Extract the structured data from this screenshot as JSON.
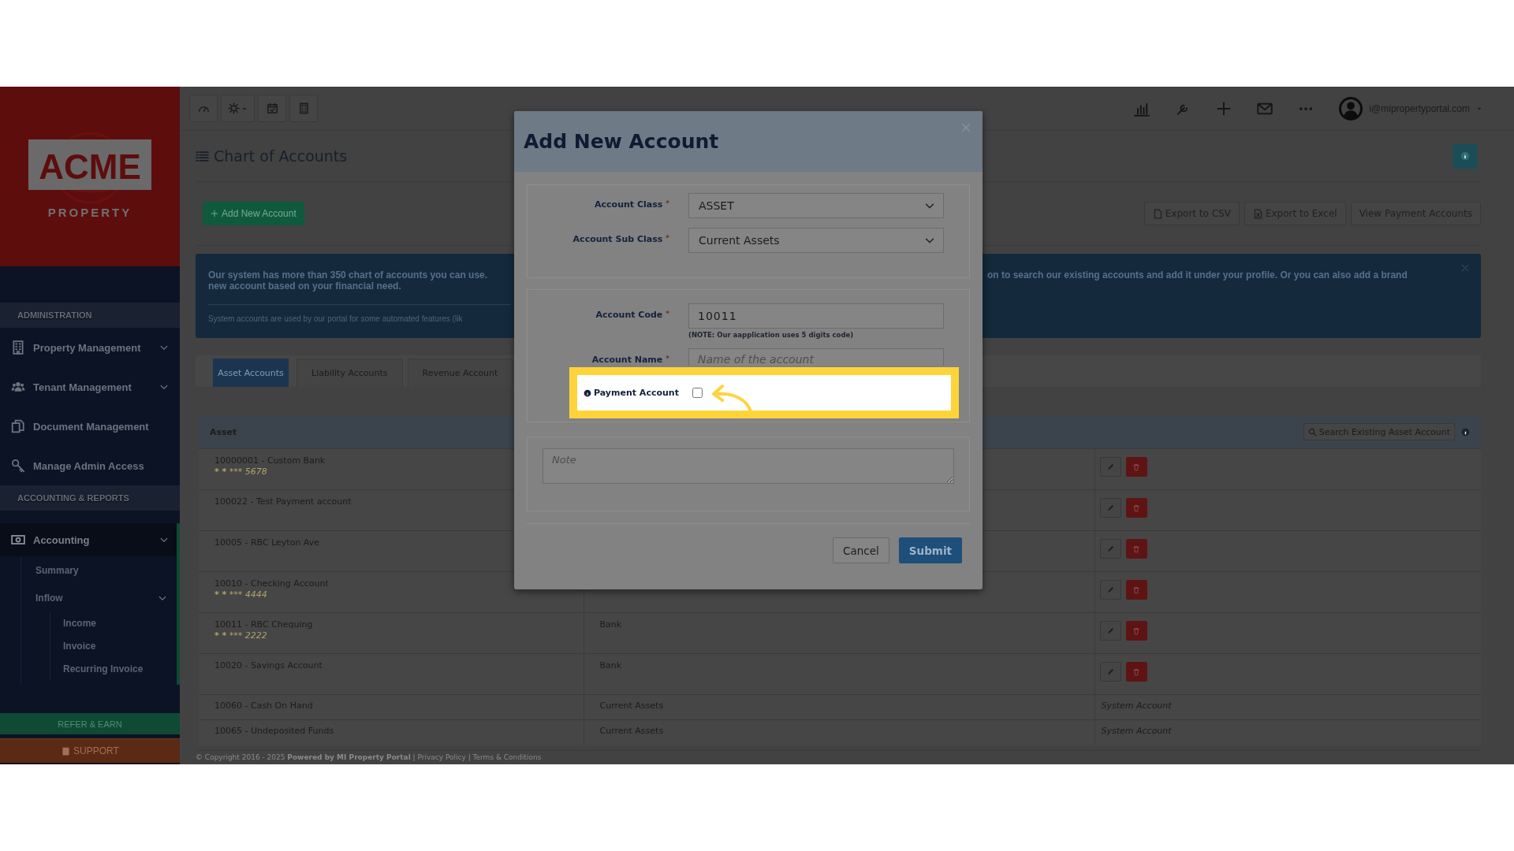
{
  "sidebar": {
    "logo": {
      "wordmark": "ACME",
      "tagline": "PROPERTY"
    },
    "sections": [
      {
        "title": "ADMINISTRATION",
        "items": [
          {
            "label": "Property Management",
            "submenu": true,
            "selected": false
          },
          {
            "label": "Tenant Management",
            "submenu": true,
            "selected": false
          },
          {
            "label": "Document Management",
            "submenu": false,
            "selected": false
          },
          {
            "label": "Manage Admin Access",
            "submenu": false,
            "selected": false
          }
        ]
      },
      {
        "title": "ACCOUNTING & REPORTS",
        "items": [
          {
            "label": "Accounting",
            "submenu": true,
            "selected": true,
            "children": [
              {
                "label": "Summary",
                "submenu": false,
                "selected": false
              },
              {
                "label": "Inflow",
                "submenu": true,
                "selected": false,
                "children": [
                  {
                    "label": "Income",
                    "selected": false
                  },
                  {
                    "label": "Invoice",
                    "selected": false
                  },
                  {
                    "label": "Recurring Invoice",
                    "selected": false
                  }
                ]
              }
            ]
          }
        ]
      }
    ],
    "refer": "REFER & EARN",
    "support": "SUPPORT"
  },
  "topbar": {
    "left_tools": [
      {
        "caret": false
      },
      {
        "caret": true
      },
      {
        "caret": false
      },
      {
        "caret": false
      }
    ],
    "user_email": "i@mipropertyportal.com"
  },
  "page": {
    "title": "Chart of Accounts",
    "add_button": "Add New Account",
    "export_buttons": [
      "Export to CSV",
      "Export to Excel",
      "View Payment Accounts"
    ]
  },
  "banner": {
    "left_lines": [
      "Our system has more than 350 chart of accounts you can use.",
      "new account based on your financial need.",
      "System accounts are used by our portal for some automated features (lik"
    ],
    "right_lines": [
      "on to search our existing accounts and add it under your profile. Or you can also add a brand"
    ]
  },
  "tabs": [
    {
      "label": "Asset Accounts",
      "selected": true
    },
    {
      "label": "Liability Accounts",
      "selected": false
    },
    {
      "label": "Revenue Account",
      "selected": false
    }
  ],
  "table": {
    "columns": [
      "Asset"
    ],
    "search_button": "Search Existing Asset Account",
    "rows": [
      {
        "name": "10000001 - Custom Bank",
        "masked": "*** *** *** 5678",
        "kind": "actions"
      },
      {
        "name": "100022 - Test Payment account",
        "kind": "actions"
      },
      {
        "name": "10005 - RBC Leyton Ave",
        "kind": "actions"
      },
      {
        "name": "10010 - Checking Account",
        "masked": "*** *** *** 4444",
        "kind": "actions"
      },
      {
        "name": "10011 - RBC Chequing",
        "masked": "*** *** *** 2222",
        "type": "Bank",
        "kind": "actions"
      },
      {
        "name": "10020 - Savings Account",
        "type": "Bank",
        "kind": "actions"
      },
      {
        "name": "10060 - Cash On Hand",
        "type": "Current Assets",
        "kind": "system",
        "note": "System Account"
      },
      {
        "name": "10065 - Undeposited Funds",
        "type": "Current Assets",
        "kind": "system",
        "note": "System Account"
      }
    ]
  },
  "footer": "© Copyright 2016 - 2025 **Powered by MI Property Portal** | Privacy Policy | Terms & Conditions",
  "modal": {
    "title": "Add New Account",
    "groups": [
      {
        "fields": [
          {
            "kind": "select",
            "label": "Account Class",
            "mark": "*",
            "value": "ASSET"
          },
          {
            "kind": "select",
            "label": "Account Sub Class",
            "mark": "*",
            "value": "Current Assets"
          }
        ]
      },
      {
        "fields": [
          {
            "kind": "input",
            "label": "Account Code",
            "mark": "*",
            "value": "10011",
            "hint": "(NOTE: Our aapplication uses 5 digits code)"
          },
          {
            "kind": "input",
            "label": "Account Name",
            "mark": "*",
            "placeholder": "Name of the account"
          }
        ]
      }
    ],
    "payment": {
      "label": "Payment Account",
      "checked": false
    },
    "note_placeholder": "Note",
    "buttons": [
      {
        "label": "Cancel",
        "kind": "default"
      },
      {
        "label": "Submit",
        "kind": "primary"
      }
    ]
  }
}
